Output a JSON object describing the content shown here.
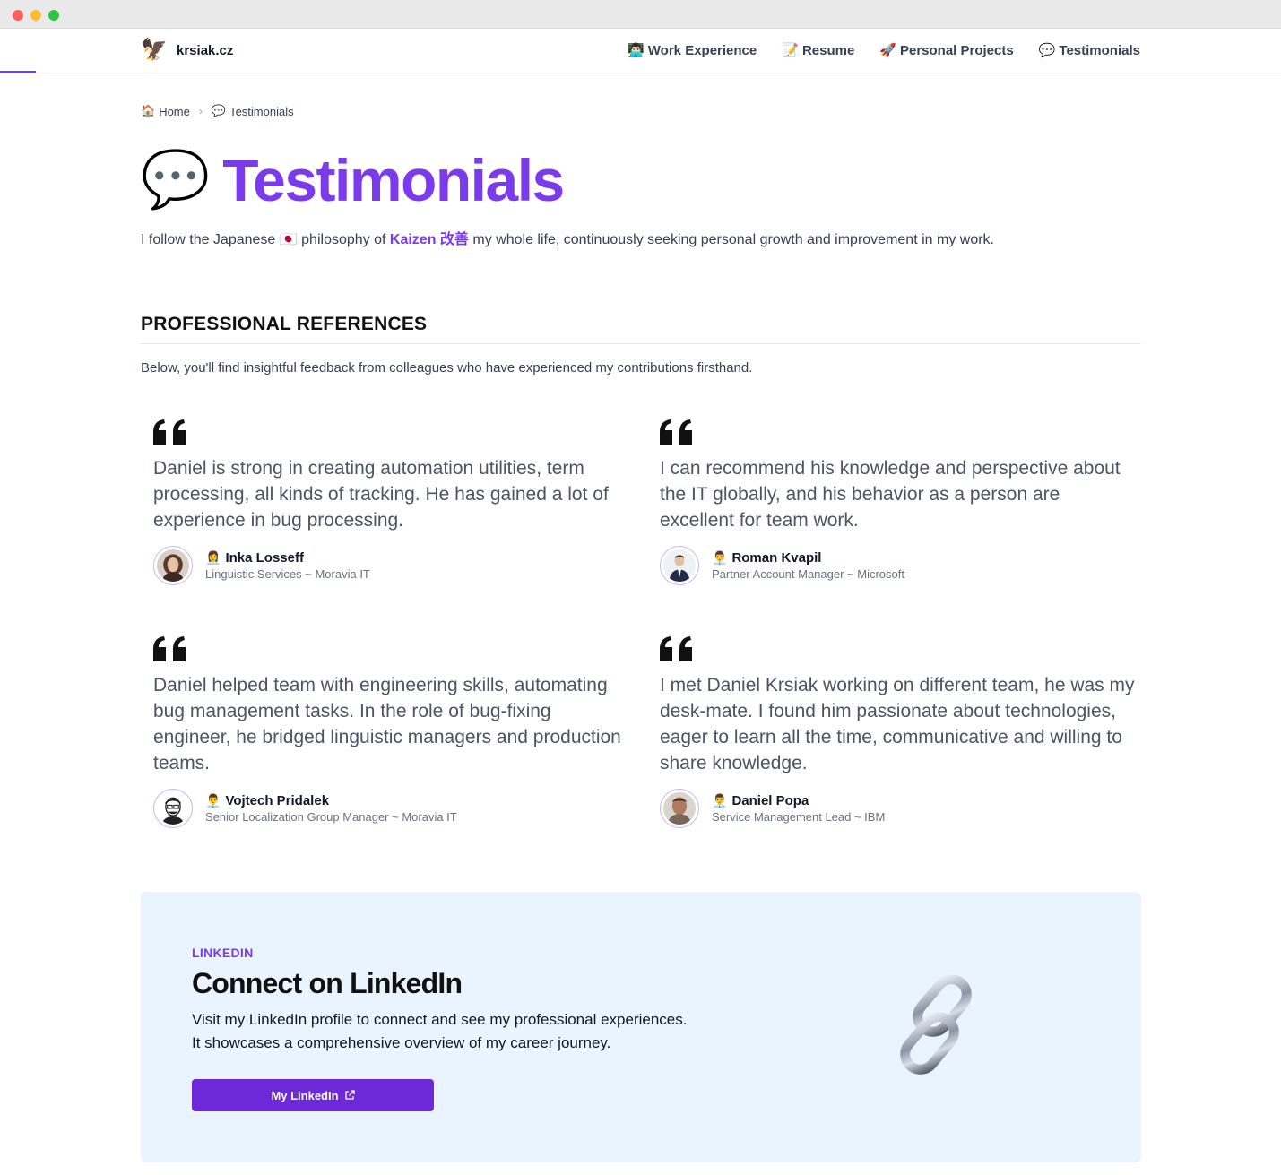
{
  "nav": {
    "brand": "krsiak.cz",
    "brand_icon": "eagle-icon",
    "links": [
      {
        "emoji": "👨🏻‍💻",
        "label": "Work Experience"
      },
      {
        "emoji": "📝",
        "label": "Resume"
      },
      {
        "emoji": "🚀",
        "label": "Personal Projects"
      },
      {
        "emoji": "💬",
        "label": "Testimonials"
      }
    ]
  },
  "breadcrumb": {
    "home_emoji": "🏠",
    "home": "Home",
    "separator": "›",
    "current_emoji": "💬",
    "current": "Testimonials"
  },
  "page": {
    "title_emoji": "💬",
    "title": "Testimonials",
    "intro_before": "I follow the Japanese",
    "intro_flag": "🇯🇵",
    "intro_middle": "philosophy of",
    "intro_kaizen": "Kaizen 改善",
    "intro_after": "my whole life, continuously seeking personal growth and improvement in my work."
  },
  "section": {
    "title": "PROFESSIONAL REFERENCES",
    "description": "Below, you'll find insightful feedback from colleagues who have experienced my contributions firsthand."
  },
  "testimonials": [
    {
      "quote": "Daniel is strong in creating automation utilities, term processing, all kinds of tracking. He has gained a lot of experience in bug processing.",
      "emoji": "👩‍💼",
      "name": "Inka Losseff",
      "role": "Linguistic Services ~ Moravia IT"
    },
    {
      "quote": "I can recommend his knowledge and perspective about the IT globally, and his behavior as a person are excellent for team work.",
      "emoji": "👨‍💼",
      "name": "Roman Kvapil",
      "role": "Partner Account Manager ~ Microsoft"
    },
    {
      "quote": "Daniel helped team with engineering skills, automating bug management tasks. In the role of bug-fixing engineer, he bridged linguistic managers and production teams.",
      "emoji": "👨‍💼",
      "name": "Vojtech Pridalek",
      "role": "Senior Localization Group Manager ~ Moravia IT"
    },
    {
      "quote": "I met Daniel Krsiak working on different team, he was my desk-mate. I found him passionate about technologies, eager to learn all the time, communicative and willing to share knowledge.",
      "emoji": "👨‍💼",
      "name": "Daniel Popa",
      "role": "Service Management Lead ~ IBM"
    }
  ],
  "linkedin": {
    "kicker": "LINKEDIN",
    "title": "Connect on LinkedIn",
    "line1": "Visit my LinkedIn profile to connect and see my professional experiences.",
    "line2": "It showcases a comprehensive overview of my career journey.",
    "button": "My LinkedIn",
    "button_icon": "external-link-icon",
    "illustration": "chain-link-icon"
  },
  "colors": {
    "accent": "#7c3aed",
    "button": "#6d28d9",
    "banner_bg": "#eaf4ff"
  }
}
